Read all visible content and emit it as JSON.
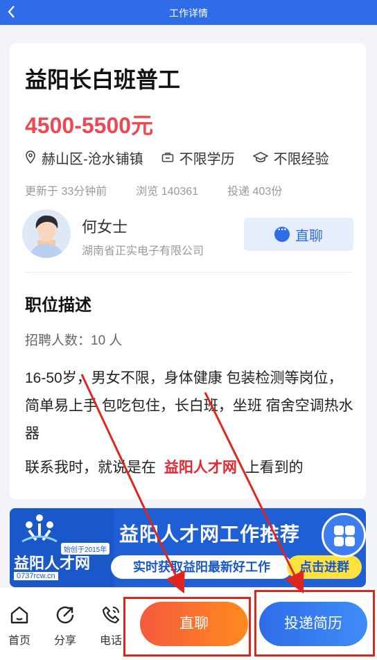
{
  "header": {
    "title": "工作详情"
  },
  "job": {
    "title": "益阳长白班普工",
    "salary": "4500-5500元",
    "location": "赫山区-沧水铺镇",
    "education": "不限学历",
    "experience": "不限经验",
    "updated": "更新于 33分钟前",
    "views": "浏览 140361",
    "applications": "投递 403份"
  },
  "recruiter": {
    "name": "何女士",
    "company": "湖南省正实电子有限公司",
    "chat_label": "直聊"
  },
  "description": {
    "section_title": "职位描述",
    "headcount": "招聘人数：10 人",
    "text": "16-50岁，男女不限，身体健康 包装检测等岗位，简单易上手 包吃包住，长白班，坐班 宿舍空调热水器",
    "contact_prefix": "联系我时，就说是在",
    "contact_brand": "益阳人才网",
    "contact_suffix": "上看到的"
  },
  "banner": {
    "logo": "益阳人才网",
    "since": "始创于2015年",
    "domain": "0737rcw.cn",
    "headline": "益阳人才网工作推荐",
    "sub": "实时获取益阳最新好工作",
    "join": "点击进群"
  },
  "bottom": {
    "home": "首页",
    "share": "分享",
    "phone": "电话",
    "chat": "直聊",
    "apply": "投递简历"
  },
  "colors": {
    "primary": "#2f6de8",
    "salary": "#ef4852",
    "highlight": "#e0241e"
  }
}
